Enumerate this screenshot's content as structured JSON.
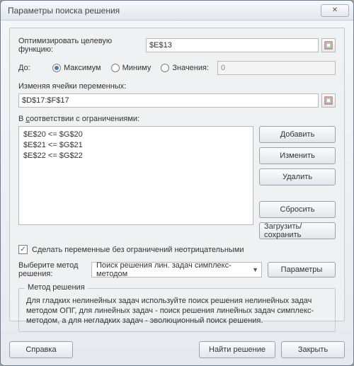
{
  "window": {
    "title": "Параметры поиска решения"
  },
  "objective": {
    "label": "Оптимизировать целевую функцию:",
    "value": "$E$13"
  },
  "to": {
    "label": "До:",
    "max": "Максимум",
    "min": "Миниму",
    "value_of": "Значения:",
    "value_input": "0",
    "selected": "max"
  },
  "changing": {
    "label": "Изменяя ячейки переменных:",
    "value": "$D$17:$F$17"
  },
  "constraints": {
    "label": "В соответствии с ограничениями:",
    "items": [
      "$E$20 <= $G$20",
      "$E$21 <= $G$21",
      "$E$22 <= $G$22"
    ],
    "buttons": {
      "add": "Добавить",
      "change": "Изменить",
      "delete": "Удалить",
      "reset": "Сбросить",
      "loadsave": "Загрузить/сохранить"
    }
  },
  "nonneg": {
    "checked": true,
    "label": "Сделать переменные без ограничений неотрицательными"
  },
  "method": {
    "label": "Выберите метод решения:",
    "selected": "Поиск решения лин. задач симплекс-методом",
    "options_button": "Параметры"
  },
  "description": {
    "title": "Метод решения",
    "body": "Для гладких нелинейных задач используйте поиск решения нелинейных задач методом ОПГ, для линейных задач - поиск решения линейных задач симплекс-методом, а для негладких задач - эволюционный поиск решения."
  },
  "footer": {
    "help": "Справка",
    "solve": "Найти решение",
    "close": "Закрыть"
  },
  "icons": {
    "close": "close-icon",
    "refedit": "range-select-icon",
    "chevron": "chevron-down-icon",
    "check": "check-icon"
  }
}
